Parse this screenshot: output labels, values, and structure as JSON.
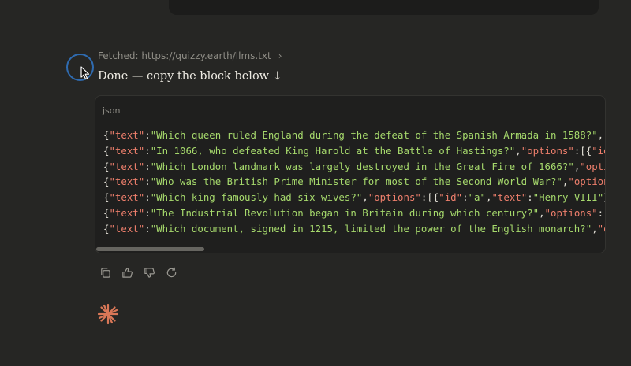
{
  "fetched": {
    "label": "Fetched: https://quizzy.earth/llms.txt",
    "chevron": "›"
  },
  "message": {
    "text": "Done — copy the block below ↓"
  },
  "code": {
    "language": "json",
    "lines": [
      [
        {
          "t": "{",
          "c": "punc"
        },
        {
          "t": "\"text\"",
          "c": "key"
        },
        {
          "t": ":",
          "c": "punc"
        },
        {
          "t": "\"Which queen ruled England during the defeat of the Spanish Armada in 1588?\"",
          "c": "str"
        },
        {
          "t": ",\"",
          "c": "punc"
        }
      ],
      [
        {
          "t": "{",
          "c": "punc"
        },
        {
          "t": "\"text\"",
          "c": "key"
        },
        {
          "t": ":",
          "c": "punc"
        },
        {
          "t": "\"In 1066, who defeated King Harold at the Battle of Hastings?\"",
          "c": "str"
        },
        {
          "t": ",",
          "c": "punc"
        },
        {
          "t": "\"options\"",
          "c": "key"
        },
        {
          "t": ":[{",
          "c": "punc"
        },
        {
          "t": "\"id",
          "c": "key"
        }
      ],
      [
        {
          "t": "{",
          "c": "punc"
        },
        {
          "t": "\"text\"",
          "c": "key"
        },
        {
          "t": ":",
          "c": "punc"
        },
        {
          "t": "\"Which London landmark was largely destroyed in the Great Fire of 1666?\"",
          "c": "str"
        },
        {
          "t": ",",
          "c": "punc"
        },
        {
          "t": "\"opti",
          "c": "key"
        }
      ],
      [
        {
          "t": "{",
          "c": "punc"
        },
        {
          "t": "\"text\"",
          "c": "key"
        },
        {
          "t": ":",
          "c": "punc"
        },
        {
          "t": "\"Who was the British Prime Minister for most of the Second World War?\"",
          "c": "str"
        },
        {
          "t": ",",
          "c": "punc"
        },
        {
          "t": "\"option",
          "c": "key"
        }
      ],
      [
        {
          "t": "{",
          "c": "punc"
        },
        {
          "t": "\"text\"",
          "c": "key"
        },
        {
          "t": ":",
          "c": "punc"
        },
        {
          "t": "\"Which king famously had six wives?\"",
          "c": "str"
        },
        {
          "t": ",",
          "c": "punc"
        },
        {
          "t": "\"options\"",
          "c": "key"
        },
        {
          "t": ":[{",
          "c": "punc"
        },
        {
          "t": "\"id\"",
          "c": "key"
        },
        {
          "t": ":",
          "c": "punc"
        },
        {
          "t": "\"a\"",
          "c": "str"
        },
        {
          "t": ",",
          "c": "punc"
        },
        {
          "t": "\"text\"",
          "c": "key"
        },
        {
          "t": ":",
          "c": "punc"
        },
        {
          "t": "\"Henry VIII\"",
          "c": "str"
        },
        {
          "t": "}",
          "c": "punc"
        }
      ],
      [
        {
          "t": "{",
          "c": "punc"
        },
        {
          "t": "\"text\"",
          "c": "key"
        },
        {
          "t": ":",
          "c": "punc"
        },
        {
          "t": "\"The Industrial Revolution began in Britain during which century?\"",
          "c": "str"
        },
        {
          "t": ",",
          "c": "punc"
        },
        {
          "t": "\"options\"",
          "c": "key"
        },
        {
          "t": ":[",
          "c": "punc"
        }
      ],
      [
        {
          "t": "{",
          "c": "punc"
        },
        {
          "t": "\"text\"",
          "c": "key"
        },
        {
          "t": ":",
          "c": "punc"
        },
        {
          "t": "\"Which document, signed in 1215, limited the power of the English monarch?\"",
          "c": "str"
        },
        {
          "t": ",",
          "c": "punc"
        },
        {
          "t": "\"o",
          "c": "key"
        }
      ]
    ]
  },
  "actions": [
    {
      "name": "copy-button",
      "icon": "copy-icon"
    },
    {
      "name": "thumbs-up-button",
      "icon": "thumbs-up-icon"
    },
    {
      "name": "thumbs-down-button",
      "icon": "thumbs-down-icon"
    },
    {
      "name": "retry-button",
      "icon": "retry-icon"
    }
  ],
  "colors": {
    "background": "#262624",
    "code_key": "#ee7f6c",
    "code_string": "#a6d96c",
    "code_punctuation": "#e2dfd6",
    "spark": "#d97757",
    "cursor_ring": "#2f6bb0"
  }
}
